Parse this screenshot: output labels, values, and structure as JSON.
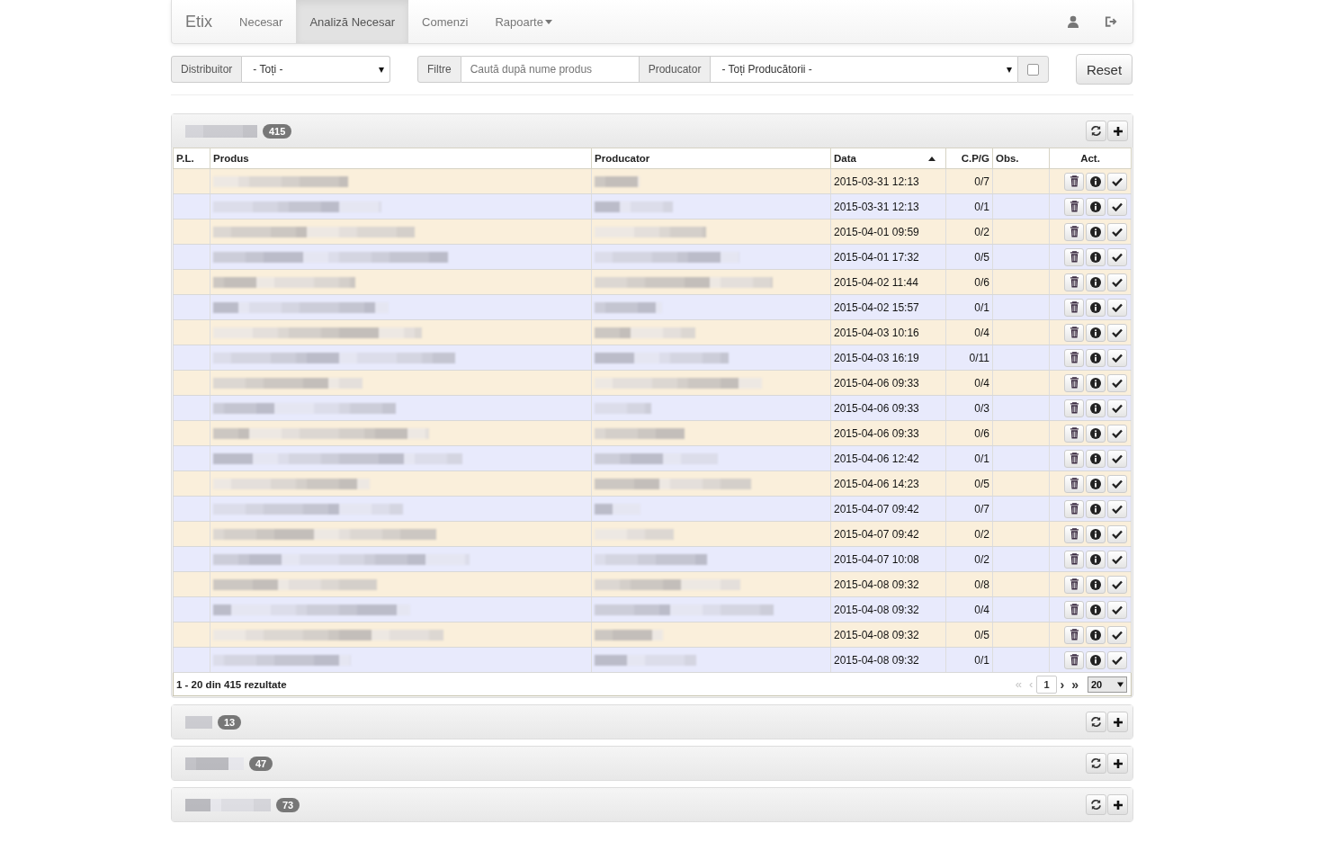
{
  "navbar": {
    "brand": "Etix",
    "items": [
      {
        "label": "Necesar",
        "selected": false,
        "dropdown": false
      },
      {
        "label": "Analiză Necesar",
        "selected": true,
        "dropdown": false
      },
      {
        "label": "Comenzi",
        "selected": false,
        "dropdown": false
      },
      {
        "label": "Rapoarte",
        "selected": false,
        "dropdown": true
      }
    ]
  },
  "filters": {
    "distributor": {
      "label": "Distribuitor",
      "value": "- Toți -"
    },
    "search": {
      "label": "Filtre",
      "placeholder": "Caută după nume produs"
    },
    "producer": {
      "label": "Producator",
      "value": "- Toți Producătorii -"
    },
    "checkbox": {
      "checked": false
    },
    "reset": "Reset"
  },
  "panels": [
    {
      "count": "415",
      "table": {
        "columns": [
          "P.L.",
          "Produs",
          "Producator",
          "Data",
          "C.P/G",
          "Obs.",
          "Act."
        ],
        "rows": [
          {
            "data": "2015-03-31 12:13",
            "cpg": "0/7"
          },
          {
            "data": "2015-03-31 12:13",
            "cpg": "0/1"
          },
          {
            "data": "2015-04-01 09:59",
            "cpg": "0/2"
          },
          {
            "data": "2015-04-01 17:32",
            "cpg": "0/5"
          },
          {
            "data": "2015-04-02 11:44",
            "cpg": "0/6"
          },
          {
            "data": "2015-04-02 15:57",
            "cpg": "0/1"
          },
          {
            "data": "2015-04-03 10:16",
            "cpg": "0/4"
          },
          {
            "data": "2015-04-03 16:19",
            "cpg": "0/11"
          },
          {
            "data": "2015-04-06 09:33",
            "cpg": "0/4"
          },
          {
            "data": "2015-04-06 09:33",
            "cpg": "0/3"
          },
          {
            "data": "2015-04-06 09:33",
            "cpg": "0/6"
          },
          {
            "data": "2015-04-06 12:42",
            "cpg": "0/1"
          },
          {
            "data": "2015-04-06 14:23",
            "cpg": "0/5"
          },
          {
            "data": "2015-04-07 09:42",
            "cpg": "0/7"
          },
          {
            "data": "2015-04-07 09:42",
            "cpg": "0/2"
          },
          {
            "data": "2015-04-07 10:08",
            "cpg": "0/2"
          },
          {
            "data": "2015-04-08 09:32",
            "cpg": "0/8"
          },
          {
            "data": "2015-04-08 09:32",
            "cpg": "0/4"
          },
          {
            "data": "2015-04-08 09:32",
            "cpg": "0/5"
          },
          {
            "data": "2015-04-08 09:32",
            "cpg": "0/1"
          }
        ],
        "summary": "1 - 20 din 415 rezultate",
        "pager": [
          {
            "label": "«",
            "disabled": true,
            "selected": false
          },
          {
            "label": "‹",
            "disabled": true,
            "selected": false
          },
          {
            "label": "1",
            "disabled": false,
            "selected": true
          },
          {
            "label": "›",
            "disabled": false,
            "selected": false
          },
          {
            "label": "»",
            "disabled": false,
            "selected": false
          }
        ],
        "page_size": "20"
      }
    },
    {
      "count": "13"
    },
    {
      "count": "47"
    },
    {
      "count": "73"
    }
  ]
}
